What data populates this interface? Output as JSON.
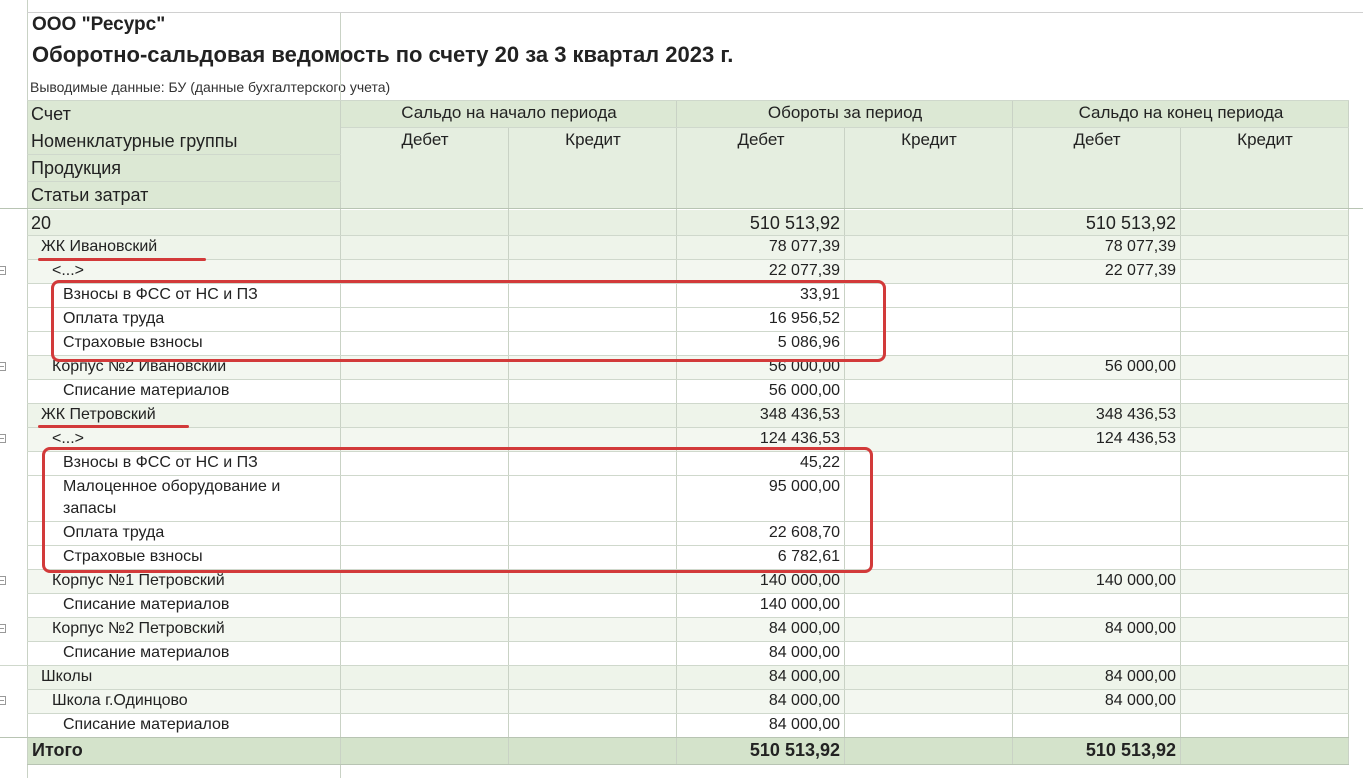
{
  "report": {
    "org": "ООО \"Ресурс\"",
    "title": "Оборотно-сальдовая ведомость по счету 20 за 3 квартал 2023 г.",
    "subtitle": "Выводимые данные: БУ (данные бухгалтерского учета)"
  },
  "header": {
    "left": [
      "Счет",
      "Номенклатурные группы",
      "Продукция",
      "Статьи затрат"
    ],
    "groups": [
      "Сальдо на начало периода",
      "Обороты за период",
      "Сальдо на конец периода"
    ],
    "debit": "Дебет",
    "credit": "Кредит"
  },
  "rows": [
    {
      "label": "20",
      "turnover_debit": "510 513,92",
      "end_debit": "510 513,92"
    },
    {
      "label": "ЖК Ивановский",
      "turnover_debit": "78 077,39",
      "end_debit": "78 077,39"
    },
    {
      "label": "<...>",
      "turnover_debit": "22 077,39",
      "end_debit": "22 077,39"
    },
    {
      "label": "Взносы в ФСС от НС и ПЗ",
      "turnover_debit": "33,91",
      "end_debit": ""
    },
    {
      "label": "Оплата труда",
      "turnover_debit": "16 956,52",
      "end_debit": ""
    },
    {
      "label": "Страховые взносы",
      "turnover_debit": "5 086,96",
      "end_debit": ""
    },
    {
      "label": "Корпус №2 Ивановский",
      "turnover_debit": "56 000,00",
      "end_debit": "56 000,00"
    },
    {
      "label": "Списание материалов",
      "turnover_debit": "56 000,00",
      "end_debit": ""
    },
    {
      "label": "ЖК Петровский",
      "turnover_debit": "348 436,53",
      "end_debit": "348 436,53"
    },
    {
      "label": "<...>",
      "turnover_debit": "124 436,53",
      "end_debit": "124 436,53"
    },
    {
      "label": "Взносы в ФСС от НС и ПЗ",
      "turnover_debit": "45,22",
      "end_debit": ""
    },
    {
      "label": "Малоценное оборудование и",
      "label2": "запасы",
      "turnover_debit": "95 000,00",
      "end_debit": ""
    },
    {
      "label": "Оплата труда",
      "turnover_debit": "22 608,70",
      "end_debit": ""
    },
    {
      "label": "Страховые взносы",
      "turnover_debit": "6 782,61",
      "end_debit": ""
    },
    {
      "label": "Корпус №1 Петровский",
      "turnover_debit": "140 000,00",
      "end_debit": "140 000,00"
    },
    {
      "label": "Списание материалов",
      "turnover_debit": "140 000,00",
      "end_debit": ""
    },
    {
      "label": "Корпус №2 Петровский",
      "turnover_debit": "84 000,00",
      "end_debit": "84 000,00"
    },
    {
      "label": "Списание материалов",
      "turnover_debit": "84 000,00",
      "end_debit": ""
    },
    {
      "label": "Школы",
      "turnover_debit": "84 000,00",
      "end_debit": "84 000,00"
    },
    {
      "label": "Школа г.Одинцово",
      "turnover_debit": "84 000,00",
      "end_debit": "84 000,00"
    },
    {
      "label": "Списание материалов",
      "turnover_debit": "84 000,00",
      "end_debit": ""
    }
  ],
  "total": {
    "label": "Итого",
    "turnover_debit": "510 513,92",
    "end_debit": "510 513,92"
  },
  "colors": {
    "header_bg": "#dce8d4",
    "group_bg": "#eef4ea",
    "total_bg": "#d4e3cb",
    "highlight": "#d23a3a"
  }
}
